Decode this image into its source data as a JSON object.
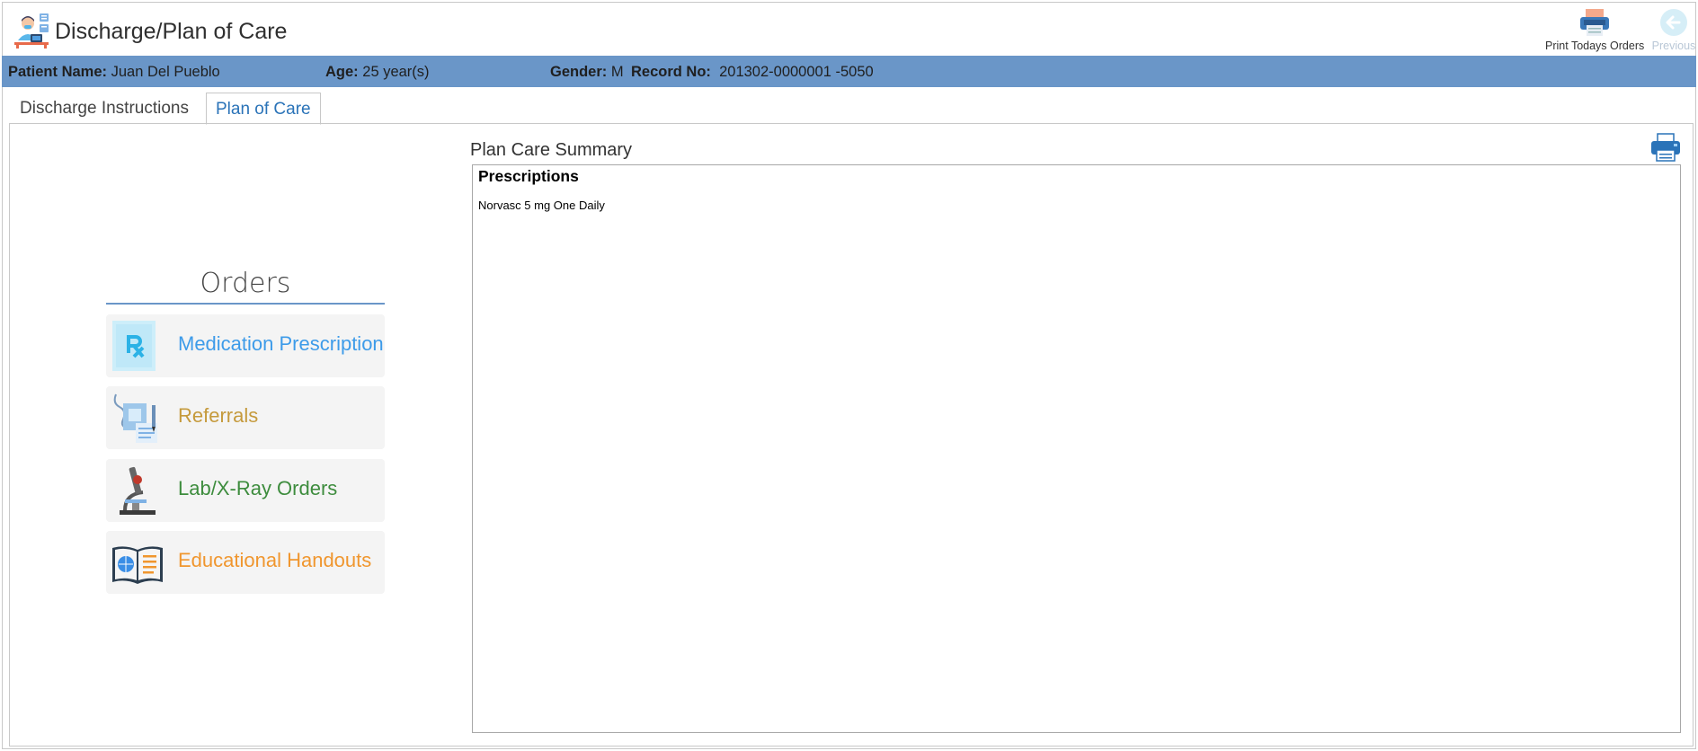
{
  "window": {
    "title": "Discharge/Plan of Care"
  },
  "toolbar": {
    "print_orders_label": "Print Todays Orders",
    "previous_label": "Previous"
  },
  "patient": {
    "name_label": "Patient Name:",
    "name_value": "Juan Del Pueblo",
    "age_label": "Age:",
    "age_value": "25 year(s)",
    "gender_label": "Gender:",
    "gender_value": "M",
    "record_label": "Record No:",
    "record_value": "201302-0000001 -5050"
  },
  "tabs": [
    {
      "label": "Discharge Instructions",
      "active": false
    },
    {
      "label": "Plan of Care",
      "active": true
    }
  ],
  "orders": {
    "title": "Orders",
    "items": [
      {
        "label": "Medication Prescription",
        "color": "#3d9be9",
        "icon": "prescription-icon"
      },
      {
        "label": "Referrals",
        "color": "#c59a3c",
        "icon": "referral-icon"
      },
      {
        "label": "Lab/X-Ray Orders",
        "color": "#3d8c3d",
        "icon": "microscope-icon"
      },
      {
        "label": "Educational Handouts",
        "color": "#f0962e",
        "icon": "book-icon"
      }
    ]
  },
  "summary": {
    "title": "Plan Care Summary",
    "section_heading": "Prescriptions",
    "lines": [
      "Norvasc 5 mg One Daily"
    ]
  },
  "colors": {
    "patient_bar": "#6a96c8",
    "active_tab": "#2a73b8"
  }
}
